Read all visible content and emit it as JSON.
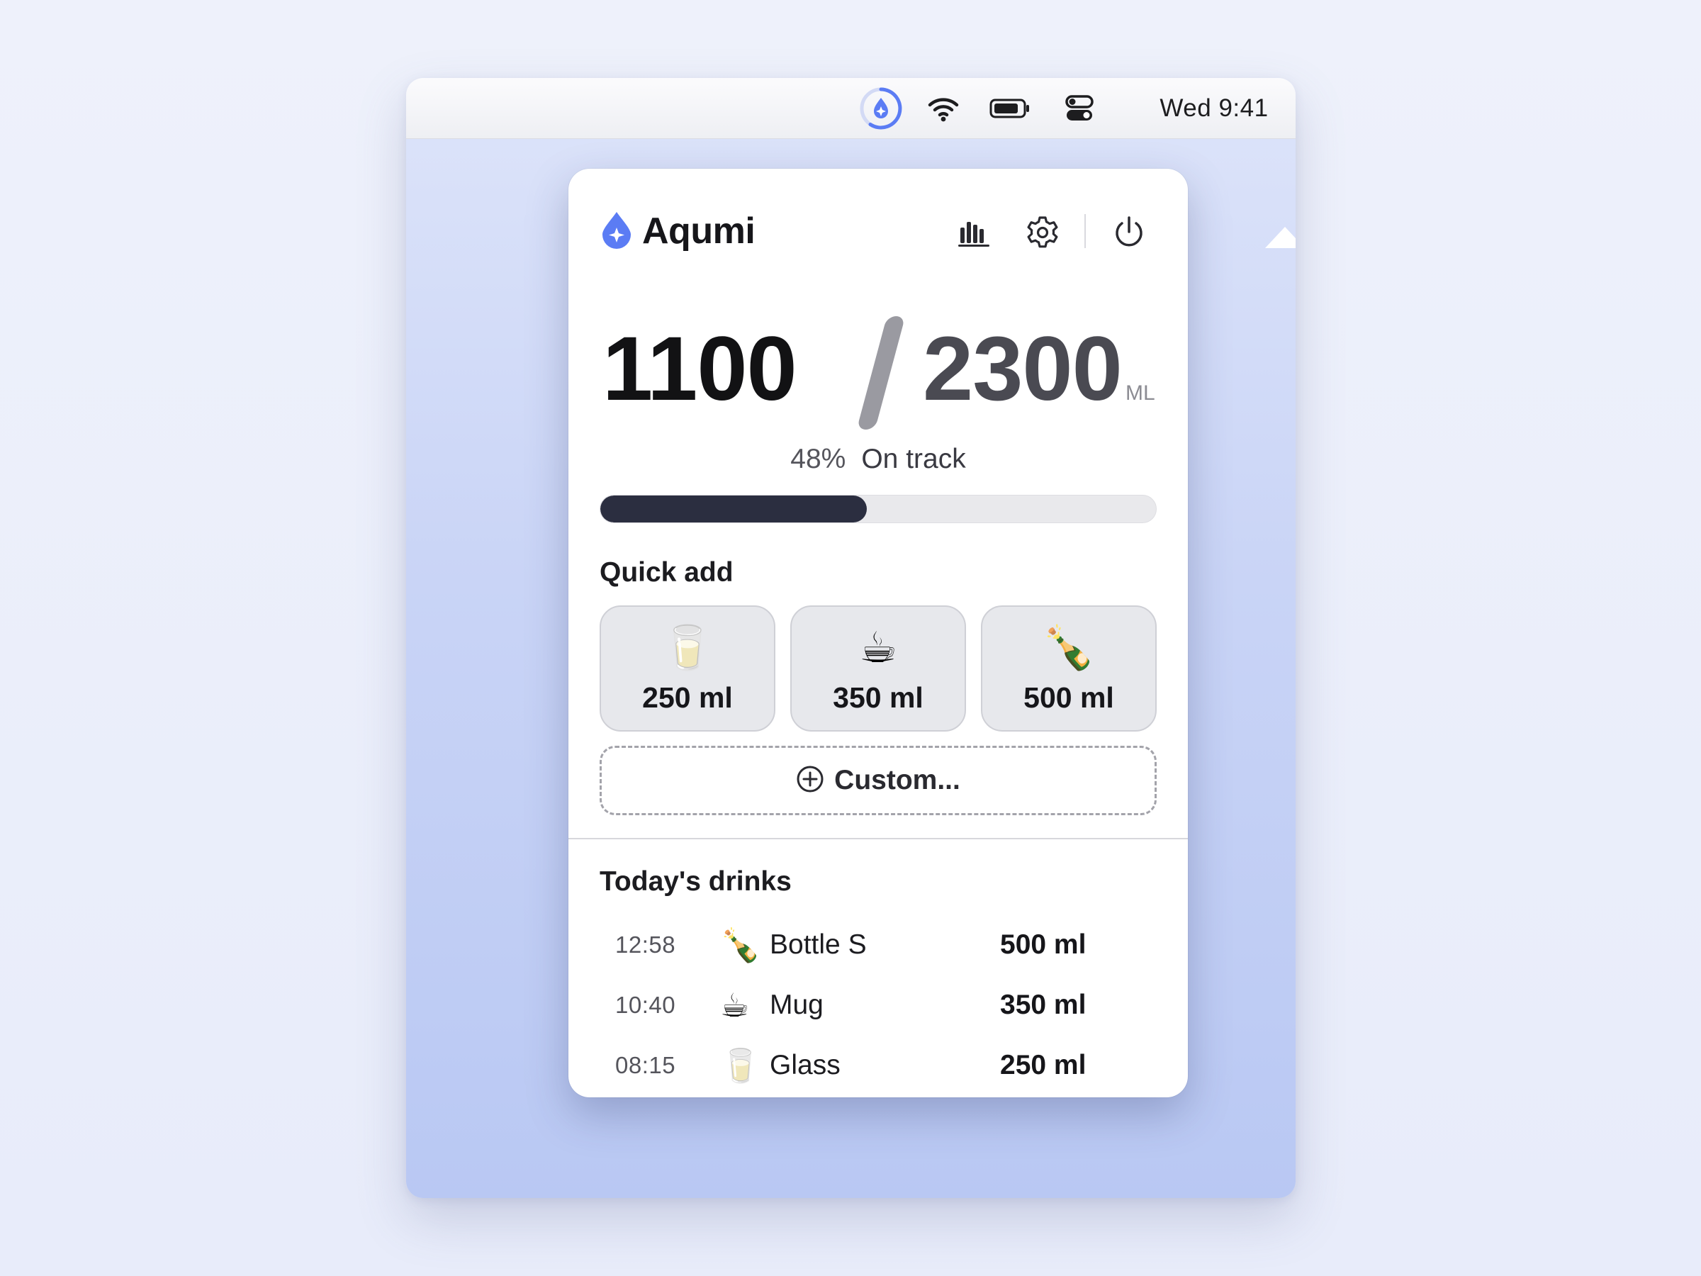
{
  "menubar": {
    "icons": [
      "aqumi-status-icon",
      "wifi-icon",
      "battery-icon",
      "control-center-icon"
    ],
    "clock": "Wed 9:41"
  },
  "app": {
    "name": "Aqumi",
    "header_icons": [
      "stats-chart-icon",
      "gear-icon",
      "power-icon"
    ]
  },
  "intake": {
    "current": "1100",
    "goal": "2300",
    "unit": "ML",
    "percent_label": "48%",
    "status_label": "On track",
    "progress": 0.48
  },
  "quick_add": {
    "title": "Quick add",
    "items": [
      {
        "emoji": "🥛",
        "icon": "glass-icon",
        "label": "250 ml"
      },
      {
        "emoji": "☕",
        "icon": "mug-icon",
        "label": "350 ml"
      },
      {
        "emoji": "🍾",
        "icon": "bottle-icon",
        "label": "500 ml"
      }
    ],
    "custom_label": "Custom..."
  },
  "todays_drinks": {
    "title": "Today's drinks",
    "rows": [
      {
        "time": "12:58",
        "emoji": "🍾",
        "name": "Bottle S",
        "amount": "500 ml"
      },
      {
        "time": "10:40",
        "emoji": "☕",
        "name": "Mug",
        "amount": "350 ml"
      },
      {
        "time": "08:15",
        "emoji": "🥛",
        "name": "Glass",
        "amount": "250 ml"
      }
    ]
  },
  "colors": {
    "accent": "#5b7cf4",
    "progress_fill": "#2b2e40",
    "progress_track": "#e9e9ec"
  }
}
